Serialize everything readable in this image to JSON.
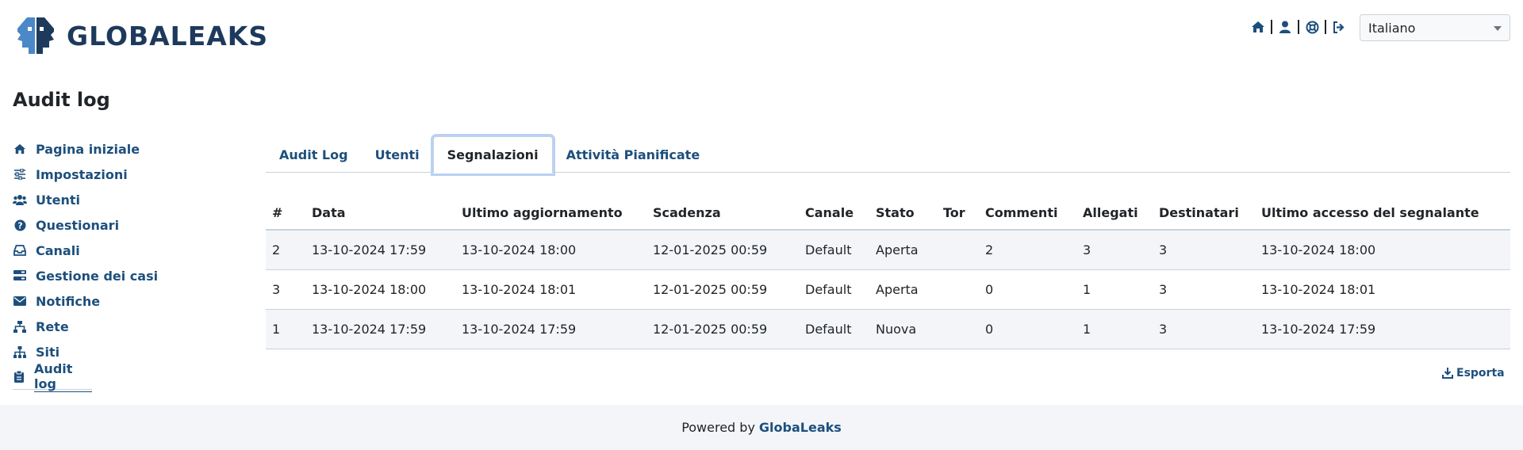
{
  "brand": {
    "name": "GLOBALEAKS",
    "logo_icon": "globaleaks-faces-logo",
    "colors": {
      "primary": "#1d3a5c",
      "link": "#1d4f7c",
      "logo_light": "#4a88c7"
    }
  },
  "header": {
    "icons": [
      "home-icon",
      "user-icon",
      "support-icon",
      "logout-icon"
    ],
    "language": {
      "selected": "Italiano"
    }
  },
  "page": {
    "title": "Audit log"
  },
  "sidebar": {
    "items": [
      {
        "label": "Pagina iniziale",
        "icon": "home-icon"
      },
      {
        "label": "Impostazioni",
        "icon": "sliders-icon"
      },
      {
        "label": "Utenti",
        "icon": "users-icon"
      },
      {
        "label": "Questionari",
        "icon": "question-circle-icon"
      },
      {
        "label": "Canali",
        "icon": "inbox-icon"
      },
      {
        "label": "Gestione dei casi",
        "icon": "tasks-icon"
      },
      {
        "label": "Notifiche",
        "icon": "envelope-icon"
      },
      {
        "label": "Rete",
        "icon": "network-icon"
      },
      {
        "label": "Siti",
        "icon": "sitemap-icon"
      },
      {
        "label": "Audit log",
        "icon": "clipboard-icon",
        "active": true
      }
    ]
  },
  "tabs": [
    {
      "label": "Audit Log"
    },
    {
      "label": "Utenti"
    },
    {
      "label": "Segnalazioni",
      "active": true
    },
    {
      "label": "Attività Pianificate"
    }
  ],
  "table": {
    "columns": [
      "#",
      "Data",
      "Ultimo aggiornamento",
      "Scadenza",
      "Canale",
      "Stato",
      "Tor",
      "Commenti",
      "Allegati",
      "Destinatari",
      "Ultimo accesso del segnalante"
    ],
    "rows": [
      [
        "2",
        "13-10-2024 17:59",
        "13-10-2024 18:00",
        "12-01-2025 00:59",
        "Default",
        "Aperta",
        "",
        "2",
        "3",
        "3",
        "13-10-2024 18:00"
      ],
      [
        "3",
        "13-10-2024 18:00",
        "13-10-2024 18:01",
        "12-01-2025 00:59",
        "Default",
        "Aperta",
        "",
        "0",
        "1",
        "3",
        "13-10-2024 18:01"
      ],
      [
        "1",
        "13-10-2024 17:59",
        "13-10-2024 17:59",
        "12-01-2025 00:59",
        "Default",
        "Nuova",
        "",
        "0",
        "1",
        "3",
        "13-10-2024 17:59"
      ]
    ]
  },
  "export": {
    "label": "Esporta",
    "icon": "download-icon"
  },
  "footer": {
    "prefix": "Powered by",
    "brand": "GlobaLeaks"
  }
}
